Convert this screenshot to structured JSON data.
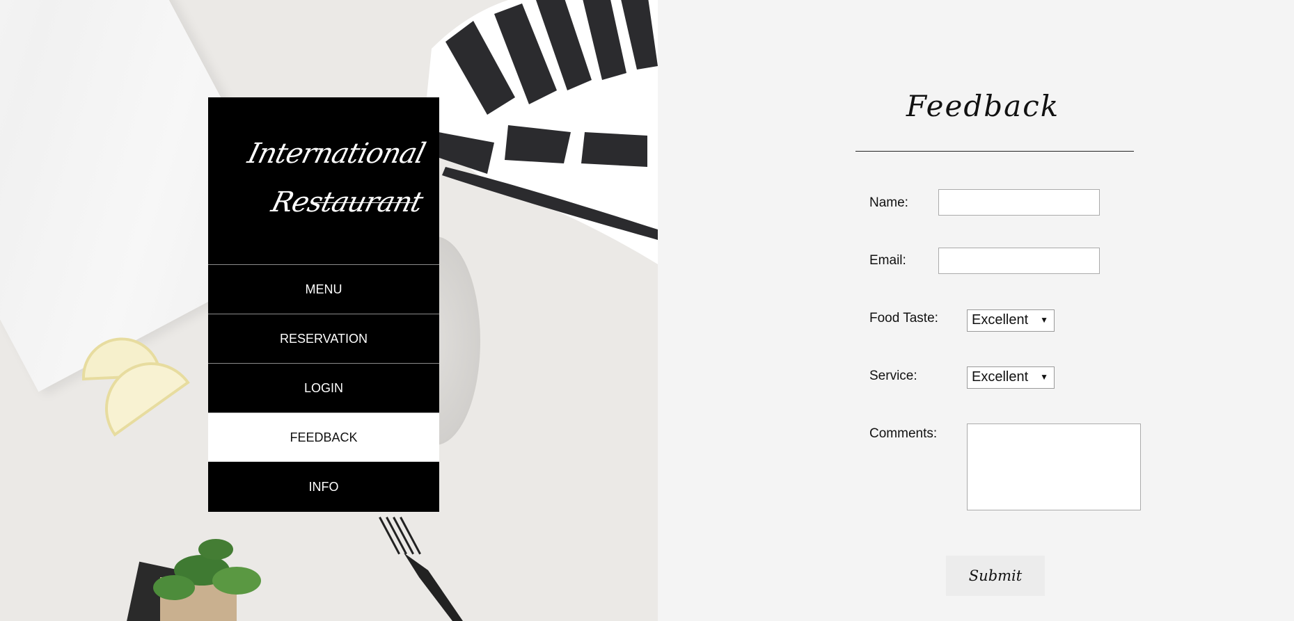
{
  "brand": {
    "line1": "International",
    "line2": "Restaurant"
  },
  "nav": {
    "items": [
      {
        "label": "MENU"
      },
      {
        "label": "RESERVATION"
      },
      {
        "label": "LOGIN"
      },
      {
        "label": "FEEDBACK",
        "active": true
      },
      {
        "label": "INFO"
      }
    ]
  },
  "feedback": {
    "title": "Feedback",
    "name_label": "Name:",
    "name_value": "",
    "email_label": "Email:",
    "email_value": "",
    "food_taste_label": "Food Taste:",
    "food_taste_selected": "Excellent",
    "service_label": "Service:",
    "service_selected": "Excellent",
    "comments_label": "Comments:",
    "comments_value": "",
    "submit_label": "Submit"
  },
  "colors": {
    "nav_background": "#000000",
    "nav_active_background": "#ffffff",
    "panel_background": "#f4f4f4",
    "submit_background": "#ececec"
  },
  "icons": {
    "select_arrow": "chevron-down-icon"
  }
}
